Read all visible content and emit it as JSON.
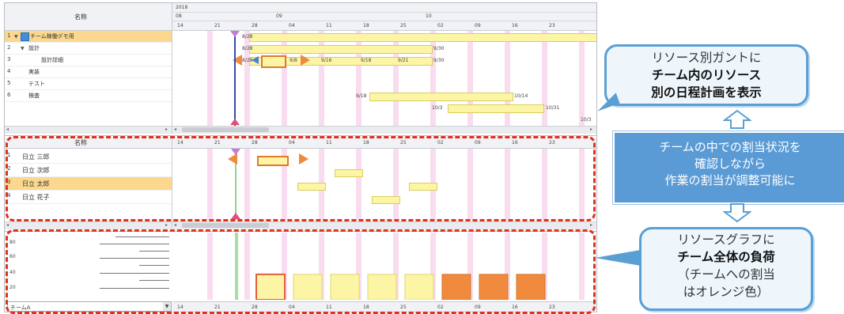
{
  "top_panel": {
    "name_header": "名称",
    "year": "2018",
    "months": [
      "08",
      "09",
      "10"
    ],
    "days": [
      "14",
      "21",
      "28",
      "04",
      "11",
      "18",
      "25",
      "02",
      "09",
      "16",
      "23"
    ],
    "rows": [
      {
        "num": "1",
        "label": "チーム稼働デモ用"
      },
      {
        "num": "2",
        "label": "設計"
      },
      {
        "num": "3",
        "label": "設計詳細"
      },
      {
        "num": "4",
        "label": "実装"
      },
      {
        "num": "5",
        "label": "テスト"
      },
      {
        "num": "6",
        "label": "検査"
      }
    ],
    "date_labels": {
      "r1": "8/28",
      "r2_start": "8/28",
      "r2_end": "9/30",
      "r3_a": "8/28",
      "r3_b": "9/8",
      "r3_c": "9/16",
      "r3_d": "9/18",
      "r3_e": "9/21",
      "r3_f": "9/30",
      "r4_start": "9/18",
      "r4_end": "10/14",
      "r5_start": "10/3",
      "r5_end": "10/31",
      "r6_end": "10/3"
    }
  },
  "middle_panel": {
    "name_header": "名称",
    "days": [
      "14",
      "21",
      "28",
      "04",
      "11",
      "18",
      "25",
      "02",
      "09",
      "16",
      "23"
    ],
    "rows": [
      {
        "num": "1",
        "label": "日立 三郎"
      },
      {
        "num": "2",
        "label": "日立 次郎"
      },
      {
        "num": "3",
        "label": "日立 太郎"
      },
      {
        "num": "4",
        "label": "日立 花子"
      }
    ]
  },
  "bottom_panel": {
    "y_ticks": [
      "80",
      "60",
      "40",
      "20"
    ],
    "team_select": "チームA",
    "days": [
      "14",
      "21",
      "28",
      "04",
      "11",
      "18",
      "25",
      "02",
      "09",
      "16",
      "23"
    ]
  },
  "chart_data": {
    "type": "bar",
    "categories": [
      "28",
      "04",
      "11",
      "18",
      "25",
      "02",
      "09",
      "16"
    ],
    "values": [
      34,
      34,
      34,
      34,
      34,
      34,
      34,
      34
    ],
    "assigned_to_team": [
      false,
      false,
      false,
      false,
      false,
      true,
      true,
      true
    ],
    "ylim": [
      0,
      90
    ]
  },
  "callouts": {
    "top": {
      "line1": "リソース別ガントに",
      "line2": "チーム内のリソース",
      "line3": "別の日程計画を表示"
    },
    "middle": {
      "line1": "チームの中での割当状況を",
      "line2": "確認しながら",
      "line3": "作業の割当が調整可能に"
    },
    "bottom": {
      "line1": "リソースグラフに",
      "line2": "チーム全体の負荷",
      "line3": "（チームへの割当",
      "line4": "はオレンジ色）"
    }
  },
  "colors": {
    "selection": "#fbd88e",
    "task_bar": "#fdf5a6",
    "weekend": "#f9dcef",
    "today_line": "#3a4ba0",
    "dashed_frame": "#e0301e",
    "orange": "#f08a3c",
    "callout_border": "#5a9fd4",
    "arrow_box": "#5b9bd5"
  }
}
